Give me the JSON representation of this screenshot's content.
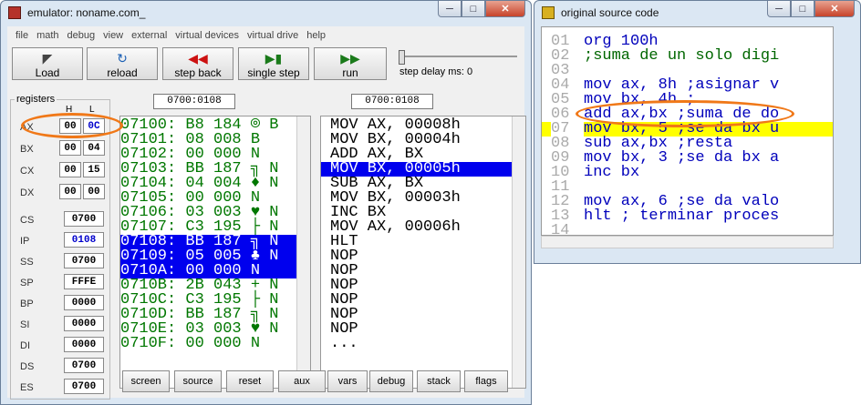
{
  "emulator": {
    "title": "emulator: noname.com_",
    "menu": [
      "file",
      "math",
      "debug",
      "view",
      "external",
      "virtual devices",
      "virtual drive",
      "help"
    ],
    "toolbar": {
      "load": "Load",
      "reload": "reload",
      "step_back": "step back",
      "single_step": "single step",
      "run": "run",
      "step_delay": "step delay ms: 0"
    },
    "registers_label": "registers",
    "h_label": "H",
    "l_label": "L",
    "regs": {
      "ax": {
        "name": "AX",
        "h": "00",
        "l": "0C"
      },
      "bx": {
        "name": "BX",
        "h": "00",
        "l": "04"
      },
      "cx": {
        "name": "CX",
        "h": "00",
        "l": "15"
      },
      "dx": {
        "name": "DX",
        "h": "00",
        "l": "00"
      }
    },
    "seg": {
      "cs": {
        "name": "CS",
        "value": "0700"
      },
      "ip": {
        "name": "IP",
        "value": "0108"
      },
      "ss": {
        "name": "SS",
        "value": "0700"
      },
      "sp": {
        "name": "SP",
        "value": "FFFE"
      },
      "bp": {
        "name": "BP",
        "value": "0000"
      },
      "si": {
        "name": "SI",
        "value": "0000"
      },
      "di": {
        "name": "DI",
        "value": "0000"
      },
      "ds": {
        "name": "DS",
        "value": "0700"
      },
      "es": {
        "name": "ES",
        "value": "0700"
      }
    },
    "mem_address": "0700:0108",
    "dis_address": "0700:0108",
    "memory": [
      "07100: B8 184 ⌾ B",
      "07101: 08 008 B",
      "07102: 00 000 N",
      "07103: BB 187 ╗ N",
      "07104: 04 004 ♦ N",
      "07105: 00 000 N",
      "07106: 03 003 ♥ N",
      "07107: C3 195 ├ N",
      "07108: BB 187 ╗ N",
      "07109: 05 005 ♣ N",
      "0710A: 00 000 N",
      "0710B: 2B 043 + N",
      "0710C: C3 195 ├ N",
      "0710D: BB 187 ╗ N",
      "0710E: 03 003 ♥ N",
      "0710F: 00 000 N"
    ],
    "disasm": [
      "MOV AX, 00008h",
      "MOV BX, 00004h",
      "ADD AX, BX",
      "MOV BX, 00005h",
      "SUB AX, BX",
      "MOV BX, 00003h",
      "INC BX",
      "MOV AX, 00006h",
      "HLT",
      "NOP",
      "NOP",
      "NOP",
      "NOP",
      "NOP",
      "NOP",
      "..."
    ],
    "bottom_buttons": [
      "screen",
      "source",
      "reset",
      "aux",
      "vars",
      "debug",
      "stack",
      "flags"
    ]
  },
  "source": {
    "title": "original source code",
    "lines": [
      {
        "num": "01",
        "text": "org 100h"
      },
      {
        "num": "02",
        "text": ";suma de un solo digi"
      },
      {
        "num": "03",
        "text": ""
      },
      {
        "num": "04",
        "text": "mov ax, 8h ;asignar v"
      },
      {
        "num": "05",
        "text": "mov bx, 4h ;"
      },
      {
        "num": "06",
        "text": "add ax,bx ;suma de do"
      },
      {
        "num": "07",
        "text": "mov bx, 5 ;se da bx u"
      },
      {
        "num": "08",
        "text": "sub ax,bx ;resta"
      },
      {
        "num": "09",
        "text": "mov bx, 3 ;se da bx a"
      },
      {
        "num": "10",
        "text": "inc bx"
      },
      {
        "num": "11",
        "text": ""
      },
      {
        "num": "12",
        "text": "mov ax, 6 ;se da valo"
      },
      {
        "num": "13",
        "text": "hlt ; terminar proces"
      },
      {
        "num": "14",
        "text": ""
      }
    ]
  },
  "colors": {
    "selection_blue": "#0000ee",
    "highlight_yellow": "#ffff00",
    "annotation_orange": "#f07818",
    "mem_green": "#007700"
  }
}
